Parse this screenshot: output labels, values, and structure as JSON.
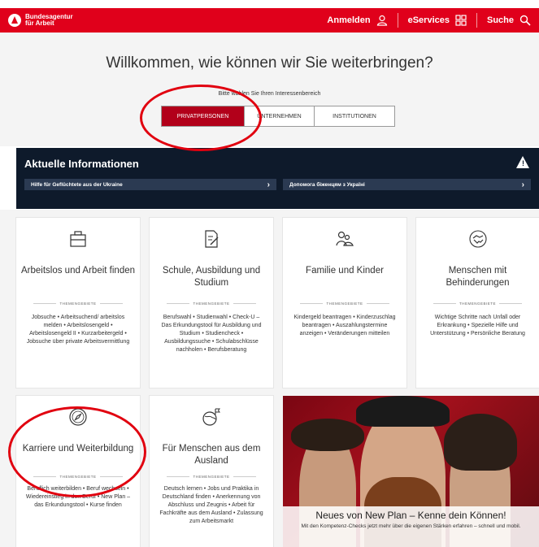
{
  "header": {
    "logo_line1": "Bundesagentur",
    "logo_line2": "für Arbeit",
    "nav": [
      {
        "label": "Anmelden",
        "icon": "user-icon"
      },
      {
        "label": "eServices",
        "icon": "grid-icon"
      },
      {
        "label": "Suche",
        "icon": "search-icon"
      }
    ]
  },
  "hero": {
    "title": "Willkommen, wie können wir Sie weiterbringen?",
    "subtitle": "Bitte wählen Sie Ihren Interessenbereich",
    "tabs": [
      {
        "label": "PRIVATPERSONEN",
        "active": true
      },
      {
        "label": "UNTERNEHMEN",
        "active": false
      },
      {
        "label": "INSTITUTIONEN",
        "active": false
      }
    ]
  },
  "info": {
    "title": "Aktuelle Informationen",
    "links": [
      {
        "label": "Hilfe für Geflüchtete aus der Ukraine"
      },
      {
        "label": "Допомога біженцям з Україні"
      }
    ]
  },
  "cards": [
    {
      "icon": "briefcase-icon",
      "title": "Arbeitslos und Arbeit finden",
      "theme": "THEMENGEBIETE",
      "topics": "Jobsuche • Arbeitsuchend/ arbeitslos melden • Arbeitslosengeld • Arbeitslosengeld II • Kurzarbeitergeld • Jobsuche über private Arbeitsvermittlung"
    },
    {
      "icon": "document-pen-icon",
      "title": "Schule, Ausbildung und Studium",
      "theme": "THEMENGEBIETE",
      "topics": "Berufswahl • Studienwahl • Check-U – Das Erkundungstool für Ausbildung und Studium • Studiencheck • Ausbildungssuche • Schulabschlüsse nachholen • Berufsberatung"
    },
    {
      "icon": "family-icon",
      "title": "Familie und Kinder",
      "theme": "THEMENGEBIETE",
      "topics": "Kindergeld beantragen • Kinderzuschlag beantragen • Auszahlungstermine anzeigen • Veränderungen mitteilen"
    },
    {
      "icon": "handshake-icon",
      "title": "Menschen mit Behinderungen",
      "theme": "THEMENGEBIETE",
      "topics": "Wichtige Schritte nach Unfall oder Erkrankung • Spezielle Hilfe und Unterstützung • Persönliche Beratung"
    },
    {
      "icon": "compass-icon",
      "title": "Karriere und Weiterbildung",
      "theme": "THEMENGEBIETE",
      "topics": "Beruflich weiterbilden • Beruf wechseln • Wiedereinstieg in den Beruf • New Plan – das Erkundungstool • Kurse finden"
    },
    {
      "icon": "globe-flag-icon",
      "title": "Für Menschen aus dem Ausland",
      "theme": "THEMENGEBIETE",
      "topics": "Deutsch lernen • Jobs und Praktika in Deutschland finden • Anerkennung von Abschluss und Zeugnis • Arbeit für Fachkräfte aus dem Ausland • Zulassung zum Arbeitsmarkt"
    }
  ],
  "promo": {
    "title": "Neues von New Plan – Kenne dein Können!",
    "text": "Mit den Kompetenz-Checks jetzt mehr über die eigenen Stärken erfahren – schnell und mobil."
  },
  "colors": {
    "brand_red": "#e0001b",
    "active_tab": "#b2001a",
    "info_bg": "#0e1a2b",
    "annotation_ring": "#e1000f"
  }
}
